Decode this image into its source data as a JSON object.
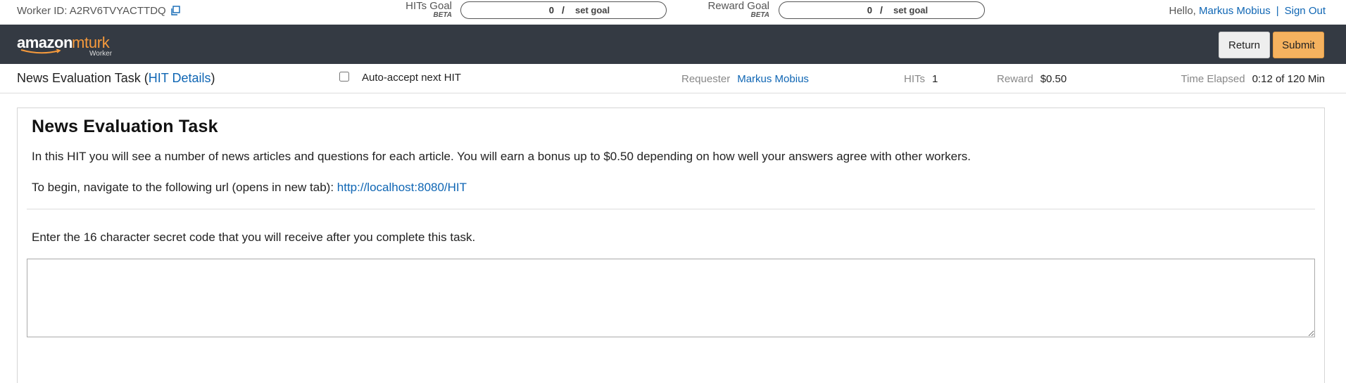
{
  "topbar": {
    "worker_id_label": "Worker ID: A2RV6TVYACTTDQ",
    "hits_goal": {
      "label": "HITs Goal",
      "beta": "BETA",
      "value": "0",
      "slash": "/",
      "set_goal": "set goal"
    },
    "reward_goal": {
      "label": "Reward Goal",
      "beta": "BETA",
      "value": "0",
      "slash": "/",
      "set_goal": "set goal"
    },
    "hello": "Hello,",
    "user_name": "Markus Mobius",
    "separator": "|",
    "sign_out": "Sign Out"
  },
  "header": {
    "logo_amazon": "amazon",
    "logo_mturk": "mturk",
    "logo_worker": "Worker",
    "return_label": "Return",
    "submit_label": "Submit",
    "colors": {
      "bar": "#343a43",
      "submit": "#f5b25f",
      "accent_link": "#0f66b4",
      "mturk_orange": "#f69a3c"
    }
  },
  "infobar": {
    "task_title": "News Evaluation Task",
    "open_paren": "(",
    "hit_details": "HIT Details",
    "close_paren": ")",
    "auto_accept": "Auto-accept next HIT",
    "auto_accept_checked": false,
    "requester_label": "Requester",
    "requester_name": "Markus Mobius",
    "hits_label": "HITs",
    "hits_value": "1",
    "reward_label": "Reward",
    "reward_value": "$0.50",
    "time_label": "Time Elapsed",
    "time_value": "0:12 of 120 Min"
  },
  "task": {
    "heading": "News Evaluation Task",
    "intro": "In this HIT you will see a number of news articles and questions for each article. You will earn a bonus up to $0.50 depending on how well your answers agree with other workers.",
    "begin_text": "To begin, navigate to the following url (opens in new tab): ",
    "begin_url": "http://localhost:8080/HIT",
    "code_prompt": "Enter the 16 character secret code that you will receive after you complete this task.",
    "code_value": ""
  }
}
